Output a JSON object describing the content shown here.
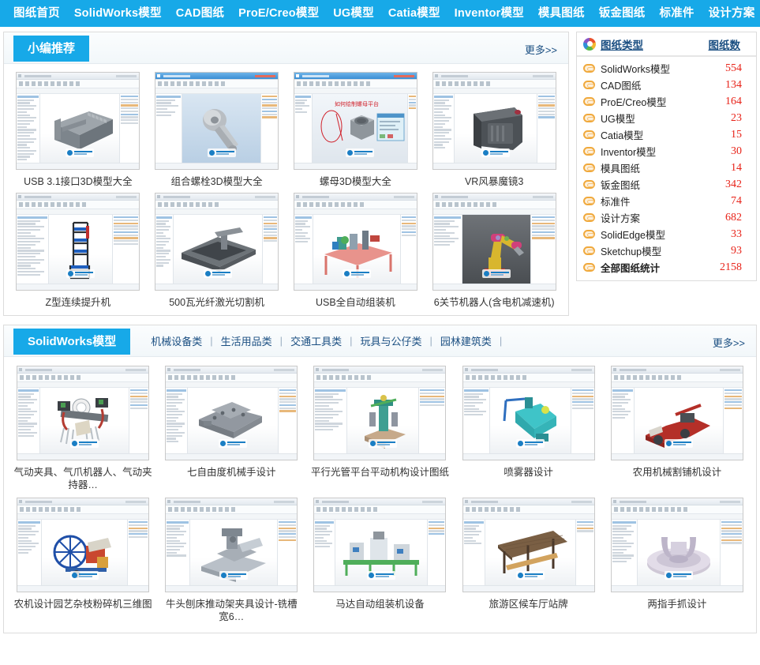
{
  "nav": {
    "items": [
      {
        "label": "图纸首页"
      },
      {
        "label": "SolidWorks模型"
      },
      {
        "label": "CAD图纸"
      },
      {
        "label": "ProE/Creo模型"
      },
      {
        "label": "UG模型"
      },
      {
        "label": "Catia模型"
      },
      {
        "label": "Inventor模型"
      },
      {
        "label": "模具图纸"
      },
      {
        "label": "钣金图纸"
      },
      {
        "label": "标准件"
      },
      {
        "label": "设计方案"
      }
    ]
  },
  "recommend": {
    "tag": "小编推荐",
    "more": "更多>>",
    "items": [
      {
        "caption": "USB 3.1接口3D模型大全"
      },
      {
        "caption": "组合螺栓3D模型大全"
      },
      {
        "caption": "螺母3D模型大全"
      },
      {
        "caption": "VR风暴魔镜3"
      },
      {
        "caption": "Z型连续提升机"
      },
      {
        "caption": "500瓦光纤激光切割机"
      },
      {
        "caption": "USB全自动组装机"
      },
      {
        "caption": "6关节机器人(含电机减速机)"
      }
    ]
  },
  "sidebar": {
    "icon": "pie-chart-icon",
    "title": "图纸类型",
    "count_header": "图纸数",
    "items": [
      {
        "label": "SolidWorks模型",
        "count": "554"
      },
      {
        "label": "CAD图纸",
        "count": "134"
      },
      {
        "label": "ProE/Creo模型",
        "count": "164"
      },
      {
        "label": "UG模型",
        "count": "23"
      },
      {
        "label": "Catia模型",
        "count": "15"
      },
      {
        "label": "Inventor模型",
        "count": "30"
      },
      {
        "label": "模具图纸",
        "count": "14"
      },
      {
        "label": "钣金图纸",
        "count": "342"
      },
      {
        "label": "标准件",
        "count": "74"
      },
      {
        "label": "设计方案",
        "count": "682"
      },
      {
        "label": "SolidEdge模型",
        "count": "33"
      },
      {
        "label": "Sketchup模型",
        "count": "93"
      },
      {
        "label": "全部图纸统计",
        "count": "2158"
      }
    ]
  },
  "solidworks": {
    "tag": "SolidWorks模型",
    "more": "更多>>",
    "categories": [
      {
        "label": "机械设备类"
      },
      {
        "label": "生活用品类"
      },
      {
        "label": "交通工具类"
      },
      {
        "label": "玩具与公仔类"
      },
      {
        "label": "园林建筑类"
      }
    ],
    "separator": "|",
    "items": [
      {
        "caption": "气动夹具、气爪机器人、气动夹持器…"
      },
      {
        "caption": "七自由度机械手设计"
      },
      {
        "caption": "平行光管平台平动机构设计图纸"
      },
      {
        "caption": "喷雾器设计"
      },
      {
        "caption": "农用机械割铺机设计"
      },
      {
        "caption": "农机设计园艺杂枝粉碎机三维图"
      },
      {
        "caption": "牛头刨床推动架夹具设计-铣槽宽6…"
      },
      {
        "caption": "马达自动组装机设备"
      },
      {
        "caption": "旅游区候车厅站牌"
      },
      {
        "caption": "两指手抓设计"
      }
    ]
  },
  "colors": {
    "accent_blue": "#17a9e8",
    "link_blue": "#1b4f82",
    "count_red": "#e8241a",
    "icon_orange": "#f0a93c"
  }
}
